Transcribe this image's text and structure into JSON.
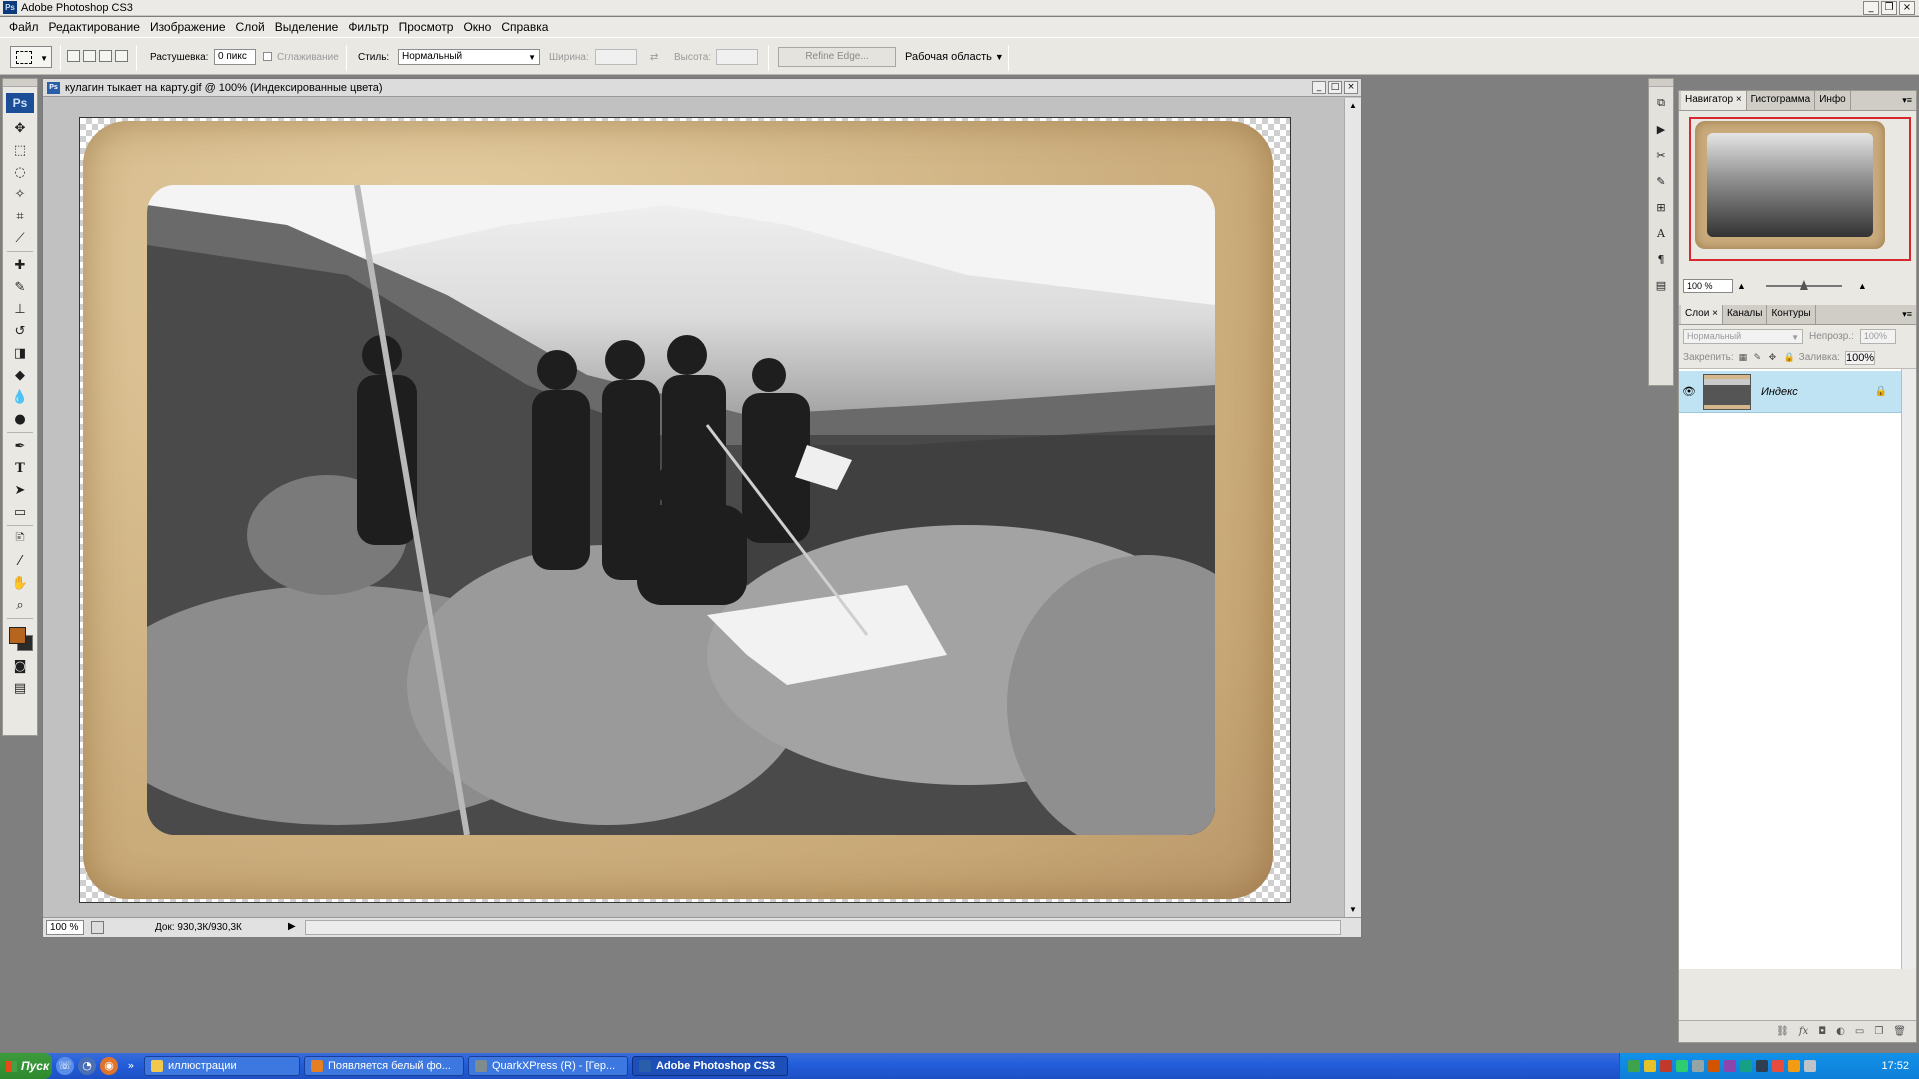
{
  "app": {
    "title": "Adobe Photoshop CS3",
    "logo_text": "Ps"
  },
  "menu": [
    "Файл",
    "Редактирование",
    "Изображение",
    "Слой",
    "Выделение",
    "Фильтр",
    "Просмотр",
    "Окно",
    "Справка"
  ],
  "options": {
    "feather_label": "Растушевка:",
    "feather_value": "0 пикс",
    "antialias_label": "Сглаживание",
    "style_label": "Стиль:",
    "style_value": "Нормальный",
    "width_label": "Ширина:",
    "height_label": "Высота:",
    "refine_label": "Refine Edge...",
    "workspace_label": "Рабочая область"
  },
  "toolbox": {
    "logo": "Ps",
    "foreground_color": "#b5651d",
    "background_color": "#2b2b2b",
    "tools": [
      "move-tool",
      "marquee-tool",
      "lasso-tool",
      "magic-wand-tool",
      "crop-tool",
      "slice-tool",
      "healing-brush-tool",
      "brush-tool",
      "clone-stamp-tool",
      "history-brush-tool",
      "eraser-tool",
      "paint-bucket-tool",
      "blur-tool",
      "dodge-tool",
      "pen-tool",
      "type-tool",
      "path-selection-tool",
      "shape-tool",
      "notes-tool",
      "eyedropper-tool",
      "hand-tool",
      "zoom-tool"
    ]
  },
  "document": {
    "title": "кулагин тыкает на карту.gif @ 100% (Индексированные цвета)",
    "icon_text": "Ps",
    "zoom": "100 %",
    "doc_size": "Док: 930,3К/930,3К"
  },
  "navigator": {
    "tabs": [
      "Навигатор",
      "Гистограмма",
      "Инфо"
    ],
    "zoom": "100 %"
  },
  "layers": {
    "tabs": [
      "Слои",
      "Каналы",
      "Контуры"
    ],
    "blend_mode": "Нормальный",
    "opacity_label": "Непрозр.:",
    "opacity_value": "100%",
    "lock_label": "Закрепить:",
    "fill_label": "Заливка:",
    "fill_value": "100%",
    "items": [
      {
        "name": "Индекс",
        "visible": true,
        "locked": true
      }
    ]
  },
  "taskbar": {
    "start_label": "Пуск",
    "tasks": [
      {
        "label": "иллюстрации",
        "active": false,
        "color": "#f2c94c"
      },
      {
        "label": "Появляется белый фо...",
        "active": false,
        "color": "#e67e22"
      },
      {
        "label": "QuarkXPress (R) - [Гер...",
        "active": false,
        "color": "#7f8c8d"
      },
      {
        "label": "Adobe Photoshop CS3",
        "active": true,
        "color": "#2a5ea8"
      }
    ],
    "clock": "17:52"
  }
}
